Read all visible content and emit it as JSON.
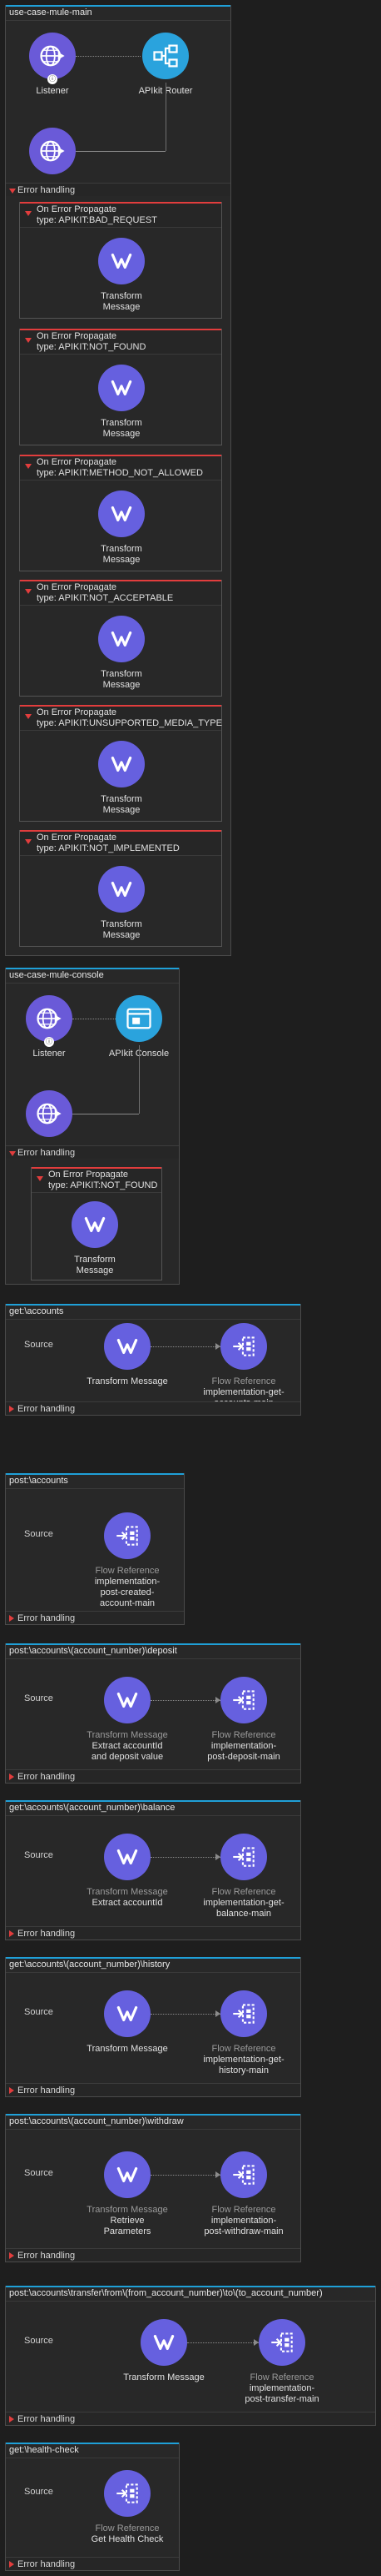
{
  "error_handling_label": "Error handling",
  "source_label": "Source",
  "flows": {
    "main": {
      "title": "use-case-mule-main",
      "listener": "Listener",
      "router": "APIkit Router",
      "scopes": [
        {
          "name": "On Error Propagate",
          "type": "type: APIKIT:BAD_REQUEST",
          "comp": "Transform Message"
        },
        {
          "name": "On Error Propagate",
          "type": "type: APIKIT:NOT_FOUND",
          "comp": "Transform Message"
        },
        {
          "name": "On Error Propagate",
          "type": "type: APIKIT:METHOD_NOT_ALLOWED",
          "comp": "Transform Message"
        },
        {
          "name": "On Error Propagate",
          "type": "type: APIKIT:NOT_ACCEPTABLE",
          "comp": "Transform Message"
        },
        {
          "name": "On Error Propagate",
          "type": "type: APIKIT:UNSUPPORTED_MEDIA_TYPE",
          "comp": "Transform Message"
        },
        {
          "name": "On Error Propagate",
          "type": "type: APIKIT:NOT_IMPLEMENTED",
          "comp": "Transform Message"
        }
      ]
    },
    "console": {
      "title": "use-case-mule-console",
      "listener": "Listener",
      "console": "APIkit Console",
      "scope": {
        "name": "On Error Propagate",
        "type": "type: APIKIT:NOT_FOUND",
        "comp": "Transform Message"
      }
    },
    "get_accounts": {
      "title": "get:\\accounts",
      "c1": {
        "l1": "",
        "l2": "Transform Message"
      },
      "c2": {
        "l1": "Flow Reference",
        "l2": "implementation-get-accounts-main"
      }
    },
    "post_accounts": {
      "title": "post:\\accounts",
      "c1": {
        "l1": "Flow Reference",
        "l2": "implementation-post-created-account-main"
      }
    },
    "post_deposit": {
      "title": "post:\\accounts\\(account_number)\\deposit",
      "c1": {
        "l1": "Transform Message",
        "l2": "Extract accountId and deposit value"
      },
      "c2": {
        "l1": "Flow Reference",
        "l2": "implementation-post-deposit-main"
      }
    },
    "get_balance": {
      "title": "get:\\accounts\\(account_number)\\balance",
      "c1": {
        "l1": "Transform Message",
        "l2": "Extract accountId"
      },
      "c2": {
        "l1": "Flow Reference",
        "l2": "implementation-get-balance-main"
      }
    },
    "get_history": {
      "title": "get:\\accounts\\(account_number)\\history",
      "c1": {
        "l1": "",
        "l2": "Transform Message"
      },
      "c2": {
        "l1": "Flow Reference",
        "l2": "implementation-get-history-main"
      }
    },
    "post_withdraw": {
      "title": "post:\\accounts\\(account_number)\\withdraw",
      "c1": {
        "l1": "Transform Message",
        "l2": "Retrieve Parameters"
      },
      "c2": {
        "l1": "Flow Reference",
        "l2": "implementation-post-withdraw-main"
      }
    },
    "post_transfer": {
      "title": "post:\\accounts\\transfer\\from\\(from_account_number)\\to\\(to_account_number)",
      "c1": {
        "l1": "",
        "l2": "Transform Message"
      },
      "c2": {
        "l1": "Flow Reference",
        "l2": "implementation-post-transfer-main"
      }
    },
    "health": {
      "title": "get:\\health-check",
      "c1": {
        "l1": "Flow Reference",
        "l2": "Get Health Check"
      }
    }
  },
  "colors": {
    "accent": "#1fa0d8",
    "error": "#e23d3d",
    "transform": "#6660df",
    "listener": "#6a5ad8"
  }
}
